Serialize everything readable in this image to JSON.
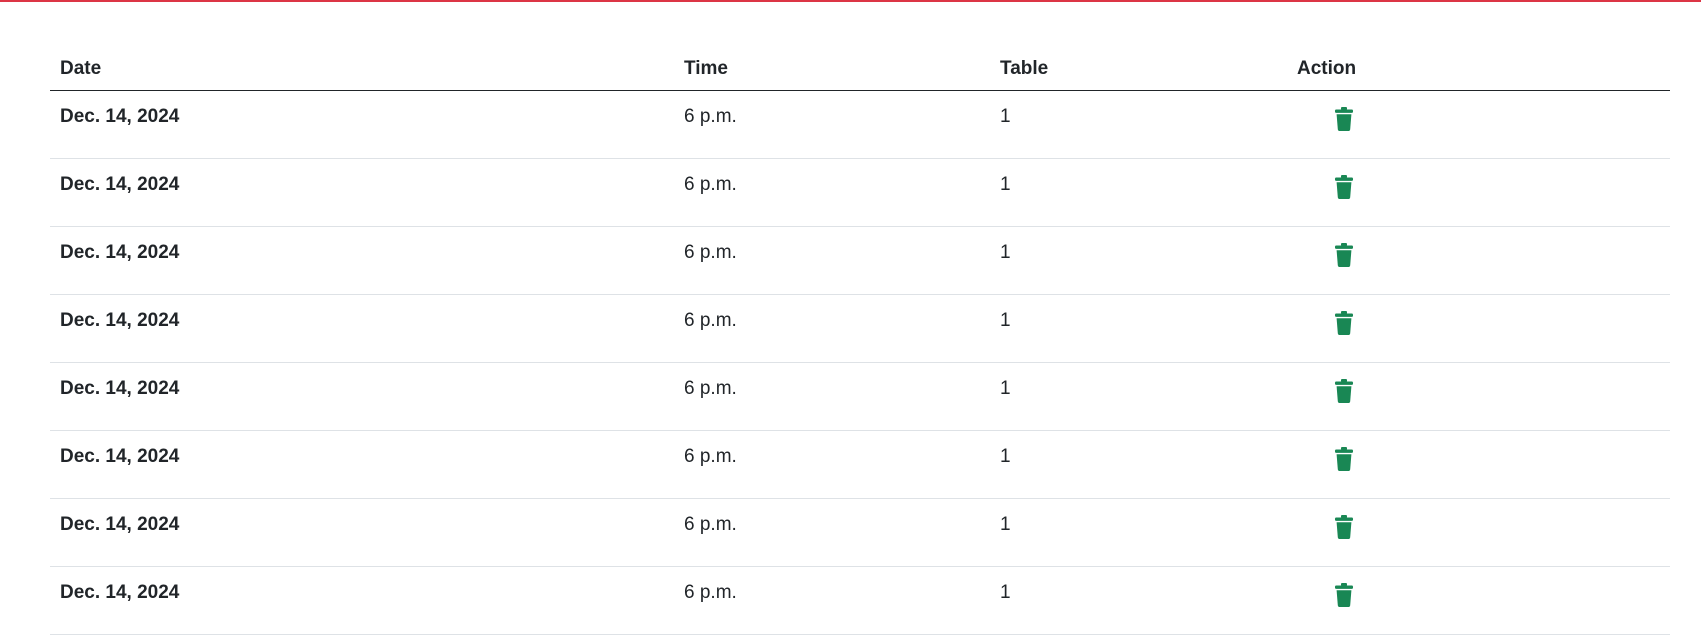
{
  "colors": {
    "accent_line": "#dc3545",
    "delete_icon": "#198754"
  },
  "table": {
    "headers": {
      "date": "Date",
      "time": "Time",
      "table": "Table",
      "action": "Action"
    },
    "rows": [
      {
        "date": "Dec. 14, 2024",
        "time": "6 p.m.",
        "table": "1",
        "action_icon": "trash-icon"
      },
      {
        "date": "Dec. 14, 2024",
        "time": "6 p.m.",
        "table": "1",
        "action_icon": "trash-icon"
      },
      {
        "date": "Dec. 14, 2024",
        "time": "6 p.m.",
        "table": "1",
        "action_icon": "trash-icon"
      },
      {
        "date": "Dec. 14, 2024",
        "time": "6 p.m.",
        "table": "1",
        "action_icon": "trash-icon"
      },
      {
        "date": "Dec. 14, 2024",
        "time": "6 p.m.",
        "table": "1",
        "action_icon": "trash-icon"
      },
      {
        "date": "Dec. 14, 2024",
        "time": "6 p.m.",
        "table": "1",
        "action_icon": "trash-icon"
      },
      {
        "date": "Dec. 14, 2024",
        "time": "6 p.m.",
        "table": "1",
        "action_icon": "trash-icon"
      },
      {
        "date": "Dec. 14, 2024",
        "time": "6 p.m.",
        "table": "1",
        "action_icon": "trash-icon"
      }
    ]
  }
}
